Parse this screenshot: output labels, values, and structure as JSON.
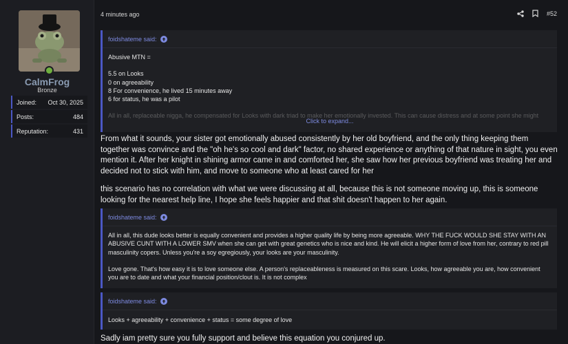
{
  "user": {
    "name": "CalmFrog",
    "rank": "Bronze",
    "stats": [
      {
        "label": "Joined:",
        "value": "Oct 30, 2025"
      },
      {
        "label": "Posts:",
        "value": "484"
      },
      {
        "label": "Reputation:",
        "value": "431"
      }
    ]
  },
  "post": {
    "time": "4 minutes ago",
    "number": "#52"
  },
  "quotes": [
    {
      "author": "foidshateme said:",
      "lines": [
        "Abusive MTN =",
        "",
        "5.5 on Looks",
        "0 on agreeability",
        "8 For convenience, he lived 15 minutes away",
        "6 for status, he was a pilot"
      ],
      "faded": "All in all, replaceable nigga, he compensated for Looks with dark triad to make her emotionally invested. This can cause distress and at some point she might",
      "expand": "Click to expand..."
    },
    {
      "author": "foidshateme said:",
      "p1": "All in all, this dude looks better is equally convenient and provides a higher quality life by being more agreeable. WHY THE FUCK WOULD SHE STAY WITH AN ABUSIVE CUNT WITH A LOWER SMV when she can get with great genetics who is nice and kind. He will elicit a higher form of love from her, contrary to red pill masculinity copers. Unless you're a soy egregiously, your looks are your masculinity.",
      "p2": "Love gone. That's how easy it is to love someone else. A person's replaceableness is measured on this scare. Looks, how agreeable you are, how convenient you are to date and what your financial position/clout is. It is not complex"
    },
    {
      "author": "foidshateme said:",
      "p1": "Looks + agreeability + convenience + status = some degree of love"
    }
  ],
  "replies": [
    "From what it sounds, your sister got emotionally abused consistently by her old boyfriend, and the only thing keeping them together was convince and the \"oh he's so cool and dark\" factor, no shared experience or anything of that nature in sight, you even mention it. After her knight in shining armor came in and comforted her, she saw how her previous boyfriend was treating her and decided not to stick with him, and move to someone who at least cared for her",
    "this scenario has no correlation with what we were discussing at all, because this is not someone moving up, this is someone looking for the nearest help line, I hope she feels happier and that shit doesn't happen to her again.",
    "Sadly iam pretty sure you fully support and believe this equation you conjured up."
  ],
  "icons": {
    "share": "share-icon",
    "bookmark": "bookmark-icon",
    "quote_arrow": "arrow-up-circle-icon",
    "online": "online-status-dot"
  },
  "colors": {
    "accent": "#4b58c5",
    "link": "#7d8ae0",
    "username": "#8a9bb2",
    "online": "#6fb03f",
    "background": "#16171b"
  }
}
